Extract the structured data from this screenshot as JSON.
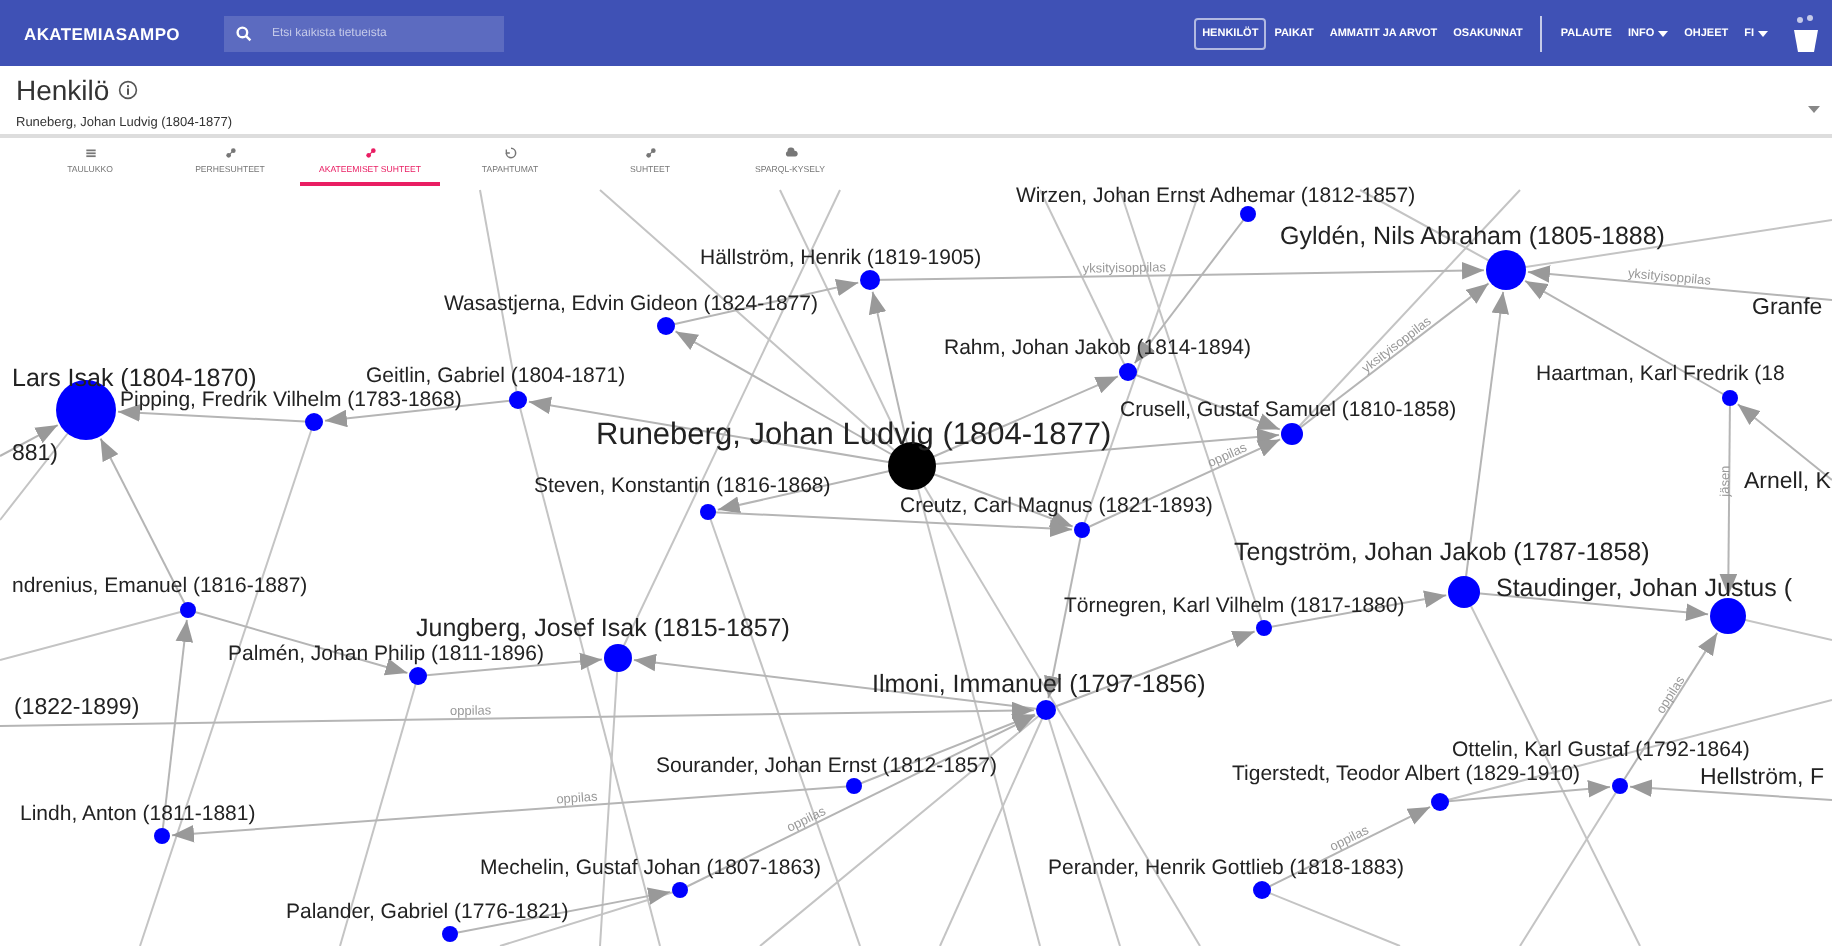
{
  "app_bar": {
    "logo": "AKATEMIASAMPO",
    "search": {
      "placeholder": "Etsi kaikista tietueista"
    },
    "nav_main": [
      {
        "label": "HENKILÖT",
        "selected": true
      },
      {
        "label": "PAIKAT",
        "selected": false
      },
      {
        "label": "AMMATIT JA ARVOT",
        "selected": false
      },
      {
        "label": "OSAKUNNAT",
        "selected": false
      }
    ],
    "nav_secondary": [
      {
        "label": "PALAUTE",
        "dropdown": false
      },
      {
        "label": "INFO",
        "dropdown": true
      },
      {
        "label": "OHJEET",
        "dropdown": false
      },
      {
        "label": "FI",
        "dropdown": true
      }
    ]
  },
  "page": {
    "title": "Henkilö",
    "subtitle": "Runeberg, Johan Ludvig (1804-1877)"
  },
  "tabs": [
    {
      "label": "TAULUKKO",
      "selected": false
    },
    {
      "label": "PERHESUHTEET",
      "selected": false
    },
    {
      "label": "AKATEEMISET SUHTEET",
      "selected": true
    },
    {
      "label": "TAPAHTUMAT",
      "selected": false
    },
    {
      "label": "SUHTEET",
      "selected": false
    },
    {
      "label": "SPARQL-KYSELY",
      "selected": false
    }
  ],
  "network": {
    "nodes": [
      {
        "label": "Runeberg, Johan Ludvig (1804-1877)",
        "kind": "focus"
      },
      {
        "label": "Lars Isak (1804-1870)",
        "kind": "hub"
      },
      {
        "label": "Pipping, Fredrik Vilhelm (1783-1868)",
        "kind": "node"
      },
      {
        "label": "Geitlin, Gabriel (1804-1871)",
        "kind": "node"
      },
      {
        "label": "Wasastjerna, Edvin Gideon (1824-1877)",
        "kind": "node"
      },
      {
        "label": "Hällström, Henrik (1819-1905)",
        "kind": "node"
      },
      {
        "label": "Wirzen, Johan Ernst Adhemar (1812-1857)",
        "kind": "node"
      },
      {
        "label": "Gyldén, Nils Abraham (1805-1888)",
        "kind": "hub"
      },
      {
        "label": "Granfe",
        "kind": "cut"
      },
      {
        "label": "Rahm, Johan Jakob (1814-1894)",
        "kind": "node"
      },
      {
        "label": "Crusell, Gustaf Samuel (1810-1858)",
        "kind": "node"
      },
      {
        "label": "Haartman, Karl Fredrik (18",
        "kind": "node"
      },
      {
        "label": "Steven, Konstantin (1816-1868)",
        "kind": "node"
      },
      {
        "label": "Creutz, Carl Magnus (1821-1893)",
        "kind": "node"
      },
      {
        "label": "Arnell, K",
        "kind": "cut"
      },
      {
        "label": "ndrenius, Emanuel (1816-1887)",
        "kind": "node"
      },
      {
        "label": "Tengström, Johan Jakob (1787-1858)",
        "kind": "hub"
      },
      {
        "label": "Staudinger, Johan Justus (",
        "kind": "hub"
      },
      {
        "label": "Jungberg, Josef Isak (1815-1857)",
        "kind": "hub"
      },
      {
        "label": "Palmén, Johan Philip (1811-1896)",
        "kind": "node"
      },
      {
        "label": "Törnegren, Karl Vilhelm (1817-1880)",
        "kind": "node"
      },
      {
        "label": "(1822-1899)",
        "kind": "cut"
      },
      {
        "label": "Ilmoni, Immanuel (1797-1856)",
        "kind": "hub"
      },
      {
        "label": "Sourander, Johan Ernst (1812-1857)",
        "kind": "node"
      },
      {
        "label": "Tigerstedt, Teodor Albert (1829-1910)",
        "kind": "node"
      },
      {
        "label": "Ottelin, Karl Gustaf (1792-1864)",
        "kind": "node"
      },
      {
        "label": "Hellström, F",
        "kind": "cut"
      },
      {
        "label": "Lindh, Anton (1811-1881)",
        "kind": "node"
      },
      {
        "label": "Mechelin, Gustaf Johan (1807-1863)",
        "kind": "node"
      },
      {
        "label": "Perander, Henrik Gottlieb (1818-1883)",
        "kind": "node"
      },
      {
        "label": "Palander, Gabriel (1776-1821)",
        "kind": "node"
      },
      {
        "label": "881)",
        "kind": "cut"
      }
    ],
    "edge_labels": [
      "oppilas",
      "oppilas",
      "oppilas",
      "oppilas",
      "oppilas",
      "yksityisoppilas",
      "yksityisoppilas",
      "yksityisoppilas",
      "jäsen",
      "oppilas"
    ]
  }
}
